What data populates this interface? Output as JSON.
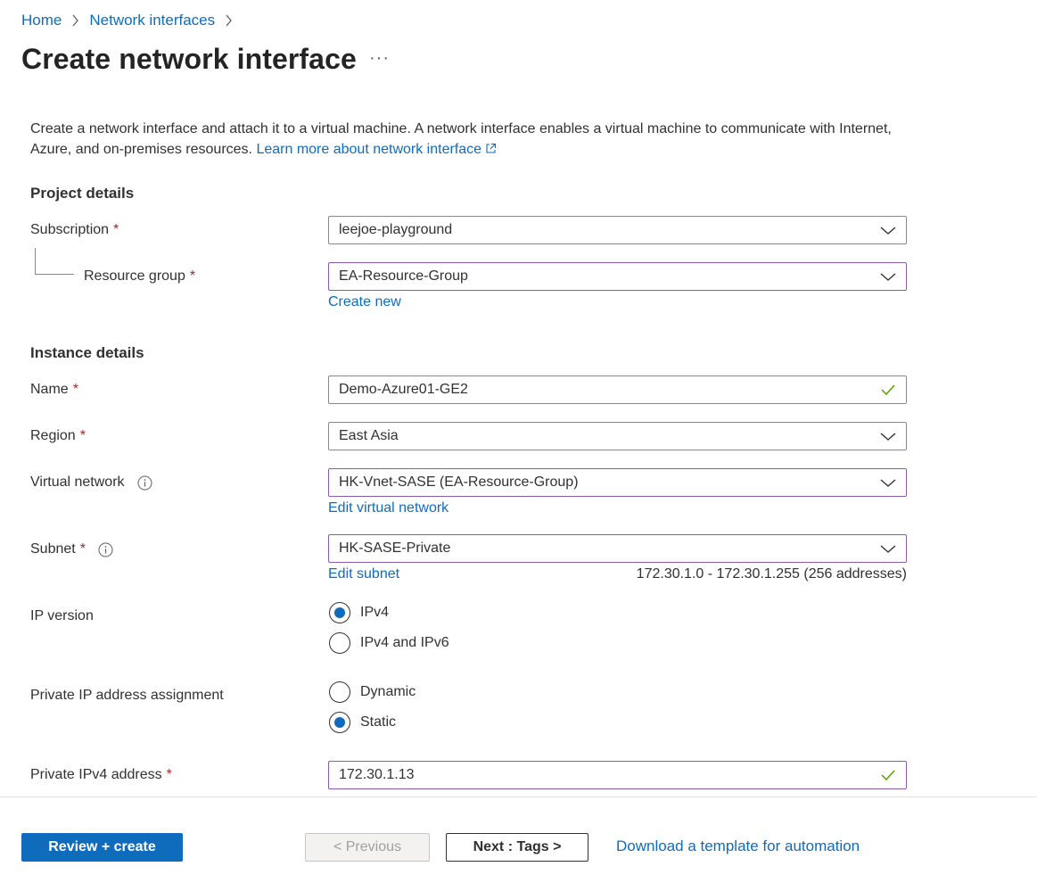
{
  "breadcrumb": {
    "items": [
      "Home",
      "Network interfaces"
    ]
  },
  "page": {
    "title": "Create network interface",
    "more_label": "···"
  },
  "intro": {
    "text": "Create a network interface and attach it to a virtual machine. A network interface enables a virtual machine to communicate with Internet, Azure, and on-premises resources. ",
    "link": "Learn more about network interface"
  },
  "project_details": {
    "title": "Project details",
    "subscription": {
      "label": "Subscription",
      "value": "leejoe-playground"
    },
    "resource_group": {
      "label": "Resource group",
      "value": "EA-Resource-Group",
      "create_new": "Create new"
    }
  },
  "instance_details": {
    "title": "Instance details",
    "name": {
      "label": "Name",
      "value": "Demo-Azure01-GE2"
    },
    "region": {
      "label": "Region",
      "value": "East Asia"
    },
    "virtual_network": {
      "label": "Virtual network",
      "value": "HK-Vnet-SASE (EA-Resource-Group)",
      "edit_link": "Edit virtual network"
    },
    "subnet": {
      "label": "Subnet",
      "value": "HK-SASE-Private",
      "edit_link": "Edit subnet",
      "range": "172.30.1.0 - 172.30.1.255 (256 addresses)"
    },
    "ip_version": {
      "label": "IP version",
      "options": [
        "IPv4",
        "IPv4 and IPv6"
      ],
      "selected": "IPv4"
    },
    "private_ip_assignment": {
      "label": "Private IP address assignment",
      "options": [
        "Dynamic",
        "Static"
      ],
      "selected": "Static"
    },
    "private_ipv4": {
      "label": "Private IPv4 address",
      "value": "172.30.1.13"
    }
  },
  "footer": {
    "review_create": "Review + create",
    "previous": "< Previous",
    "next": "Next : Tags >",
    "download_template": "Download a template for automation"
  },
  "colors": {
    "accent": "#0f6cbd",
    "required": "#a4262c",
    "focus_border": "#8b5ba6",
    "valid_check": "#57a300"
  },
  "icons": [
    "chevron-right-icon",
    "more-icon",
    "external-link-icon",
    "chevron-down-icon",
    "checkmark-icon",
    "info-icon"
  ]
}
